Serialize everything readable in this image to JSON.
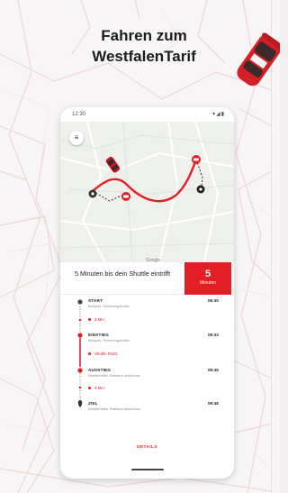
{
  "headline": "Fahren zum WestfalenTarif",
  "phone": {
    "status_time": "12:30",
    "status_icons": "▾◢▮",
    "map_button_icon": "≡",
    "map_credit": "Google",
    "eta_text": "5 Minuten bis dein Shuttle eintrifft",
    "eta_badge_number": "5",
    "eta_badge_unit": "Minuten",
    "stops": [
      {
        "label": "START",
        "sub": "Beispiel, Schubringstraße",
        "time": "09:30"
      },
      {
        "label": "EINSTIEG",
        "sub": "Beispiel, Schubringstraße",
        "time": "09:33"
      },
      {
        "label": "AUSSTIEG",
        "sub": "Westerholter Rathaus Anschluss",
        "time": "09:45"
      },
      {
        "label": "ZIEL",
        "sub": "Westerholter Rathaus Anschluss",
        "time": "09:48"
      }
    ],
    "walk_1": "3 Min.",
    "shuttle_info": "Shuttle R123",
    "walk_2": "3 Min.",
    "details_label": "DETAILS"
  },
  "colors": {
    "accent": "#e31e24",
    "map_street": "#f3dada",
    "background": "#f7f5f5"
  }
}
